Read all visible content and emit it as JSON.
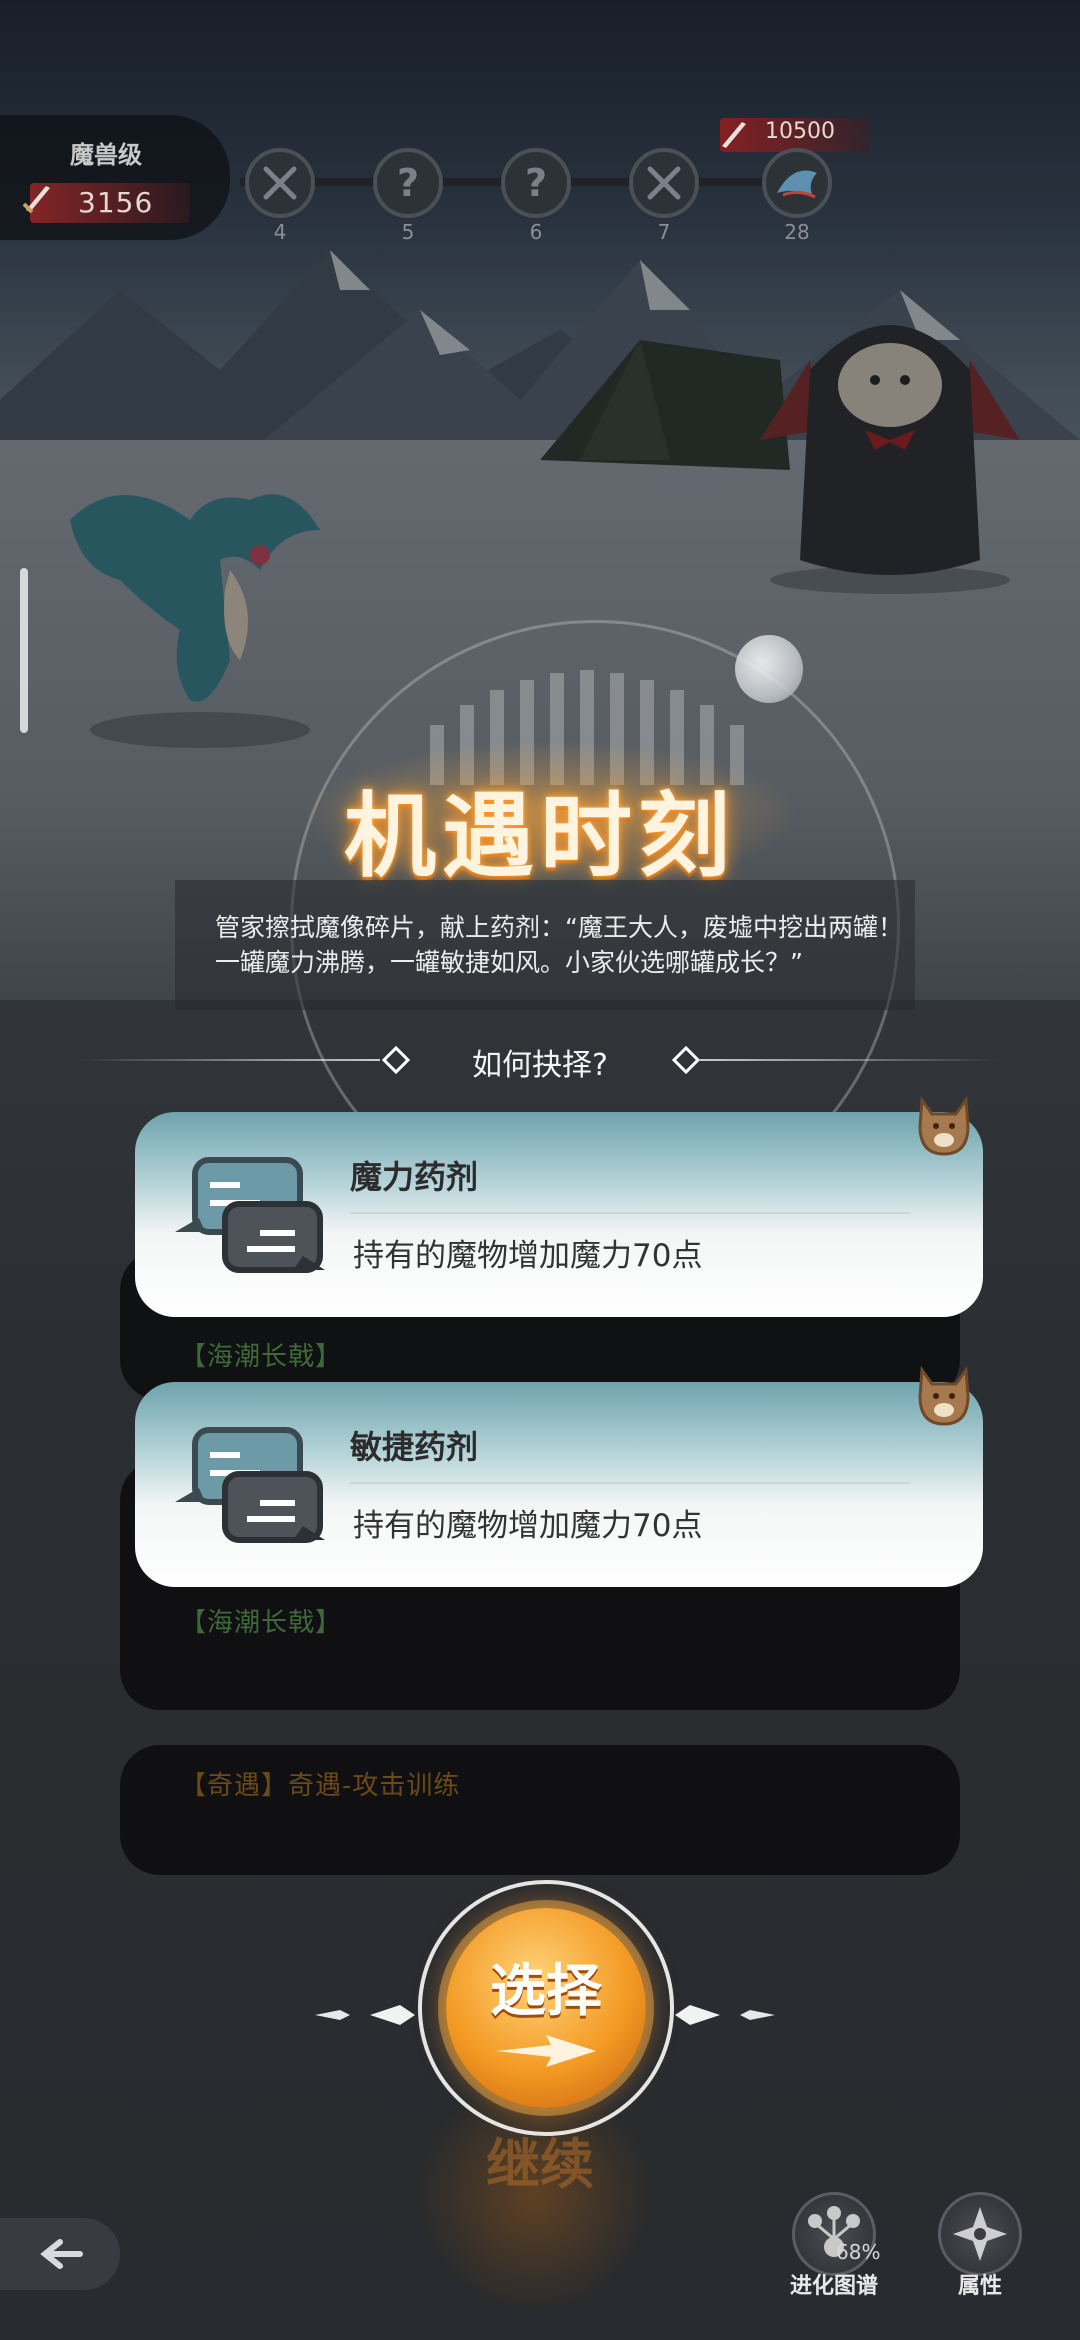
{
  "header": {
    "rank_title": "魔兽级",
    "power": "3156",
    "target_power": "10500",
    "stages": [
      {
        "num": "4",
        "icon": "crossed-swords-icon"
      },
      {
        "num": "5",
        "icon": "question-icon",
        "symbol": "?"
      },
      {
        "num": "6",
        "icon": "question-icon",
        "symbol": "?"
      },
      {
        "num": "7",
        "icon": "crossed-swords-icon"
      },
      {
        "num": "28",
        "icon": "boss-icon"
      }
    ]
  },
  "event": {
    "title": "机遇时刻",
    "story": "管家擦拭魔像碎片，献上药剂：“魔王大人，废墟中挖出两罐！一罐魔力沸腾，一罐敏捷如风。小家伙选哪罐成长？”",
    "question": "如何抉择?"
  },
  "choices": [
    {
      "name": "魔力药剂",
      "desc": "持有的魔物增加魔力70点"
    },
    {
      "name": "敏捷药剂",
      "desc": "持有的魔物增加魔力70点"
    }
  ],
  "background_panels": [
    {
      "text": "【海潮长戟】",
      "color": "#3e6a3a"
    },
    {
      "text": "【海潮长戟】",
      "color": "#3e6a3a"
    },
    {
      "text": "【奇遇】奇遇-攻击训练",
      "color": "#6b4a18"
    }
  ],
  "actions": {
    "select_label": "选择",
    "continue_label": "继续"
  },
  "bottom_bar": {
    "evolution_label": "进化图谱",
    "evolution_percent": "68%",
    "attributes_label": "属性"
  },
  "colors": {
    "accent_orange": "#f39a23",
    "card_top": "#6ea3ad",
    "title_glow": "#ff9a2e"
  }
}
